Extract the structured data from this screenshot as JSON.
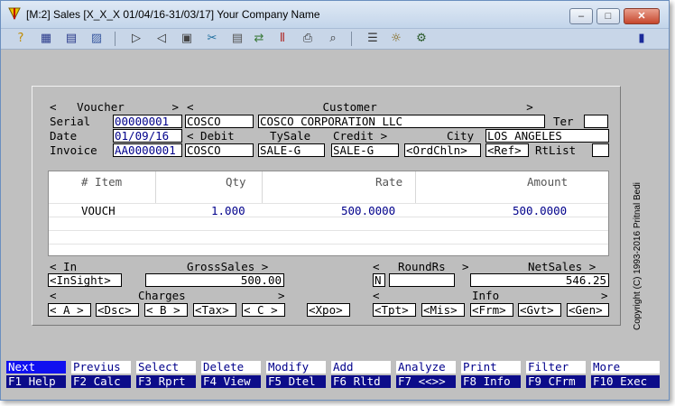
{
  "window": {
    "title": "[M:2]  Sales  [X_X_X  01/04/16-31/03/17]  Your Company Name",
    "minimize_symbol": "–",
    "maximize_symbol": "□",
    "close_symbol": "✕"
  },
  "toolbar": {
    "icons": [
      "help-icon",
      "grid-icon",
      "table-icon",
      "report-icon",
      "next-arrow-icon",
      "prev-arrow-icon",
      "open-icon",
      "tools-icon",
      "copy-icon",
      "transfer-icon",
      "chart-icon",
      "print-icon",
      "search-icon",
      "notes-icon",
      "preview-icon",
      "settings-icon",
      "exit-icon"
    ],
    "glyphs": [
      "?",
      "▦",
      "▤",
      "▨",
      "▷",
      "◁",
      "▣",
      "✂",
      "▤",
      "⇄",
      "Ⅱ",
      "⎙",
      "⌕",
      "☰",
      "☼",
      "⚙",
      "▮"
    ]
  },
  "voucher": {
    "header": "<   Voucher       >",
    "serial_label": "Serial",
    "serial": "00000001",
    "date_label": "Date",
    "date": "01/09/16",
    "invoice_label": "Invoice",
    "invoice": "AA0000001"
  },
  "customer": {
    "header": "<                   Customer                      >",
    "code": "COSCO",
    "name": "COSCO CORPORATION LLC",
    "ter_label": "Ter",
    "ter": "",
    "debit_label": "< Debit",
    "debit": "COSCO",
    "tysale_label": "TySale",
    "tysale": "SALE-G",
    "credit_label": "Credit >",
    "credit": "SALE-G",
    "city_label": "City",
    "city": "LOS ANGELES",
    "ordchln": "<OrdChln>",
    "ref": "<Ref>",
    "rtlist_label": "RtList",
    "rtlist": ""
  },
  "items": {
    "columns": [
      "# Item",
      "Qty",
      "Rate",
      "Amount"
    ],
    "rows": [
      {
        "item": "VOUCH",
        "qty": "1.000",
        "rate": "500.0000",
        "amount": "500.0000"
      }
    ]
  },
  "totals": {
    "in_label": "< In",
    "insight": "<InSight>",
    "grosssales_label": "GrossSales >",
    "grosssales": "500.00",
    "roundrs_label": "RoundRs",
    "roundrs_left": "<",
    "roundrs_right": ">",
    "round_flag": "N",
    "roundrs": "",
    "netsales_label": "NetSales >",
    "netsales": "546.25"
  },
  "charges": {
    "header_left": "<",
    "header_label": "Charges",
    "header_right": ">",
    "buttons": [
      "< A >",
      "<Dsc>",
      "< B >",
      "<Tax>",
      "< C >"
    ],
    "xpo": "<Xpo>"
  },
  "info": {
    "header_left": "<",
    "header_label": "Info",
    "header_right": ">",
    "buttons": [
      "<Tpt>",
      "<Mis>",
      "<Frm>",
      "<Gvt>",
      "<Gen>"
    ]
  },
  "function_keys": {
    "top": [
      "Next",
      "Previus",
      "Select",
      "Delete",
      "Modify",
      "Add",
      "Analyze",
      "Print",
      "Filter",
      "More"
    ],
    "bottom": [
      "F1 Help",
      "F2 Calc",
      "F3 Rprt",
      "F4 View",
      "F5 Dtel",
      "F6 Rltd",
      "F7 <<>>",
      "F8 Info",
      "F9 CFrm",
      "F10 Exec"
    ]
  },
  "copyright": "Copyright (C) 1993-2016 Pritnal Bedi",
  "colors": {
    "window_bg": "#c0c0c0",
    "field_text": "#00008b",
    "fkey_bar": "#0c0c8a",
    "fkey_selected": "#1010f0"
  }
}
